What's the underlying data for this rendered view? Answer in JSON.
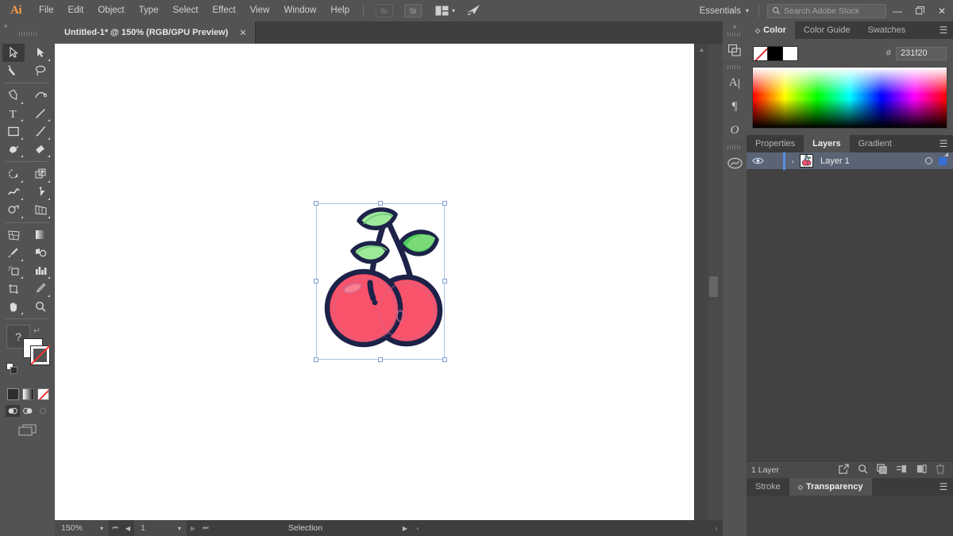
{
  "app": {
    "logo": "Ai",
    "menus": [
      "File",
      "Edit",
      "Object",
      "Type",
      "Select",
      "Effect",
      "View",
      "Window",
      "Help"
    ],
    "toolbar_buttons": [
      {
        "name": "bridge-button",
        "label": "Br",
        "enabled": false
      },
      {
        "name": "stock-button",
        "label": "St",
        "enabled": true
      }
    ],
    "arrange_documents_label": "",
    "workspace": {
      "label": "Essentials",
      "chevron": "▾"
    },
    "stock_search": {
      "placeholder": "Search Adobe Stock",
      "value": "",
      "icon": "search-icon"
    },
    "window_controls": {
      "minimize": "—",
      "restore": "❐",
      "close": "✕"
    }
  },
  "document_tab": {
    "title": "Untitled-1* @ 150% (RGB/GPU Preview)",
    "close": "✕"
  },
  "tools": {
    "items": [
      {
        "name": "selection-tool",
        "selected": true,
        "submenu": false
      },
      {
        "name": "direct-selection-tool",
        "selected": false,
        "submenu": true
      },
      {
        "name": "magic-wand-tool",
        "selected": false,
        "submenu": false
      },
      {
        "name": "lasso-tool",
        "selected": false,
        "submenu": false
      },
      {
        "name": "pen-tool",
        "selected": false,
        "submenu": true
      },
      {
        "name": "curvature-tool",
        "selected": false,
        "submenu": false
      },
      {
        "name": "type-tool",
        "selected": false,
        "submenu": true
      },
      {
        "name": "line-segment-tool",
        "selected": false,
        "submenu": true
      },
      {
        "name": "rectangle-tool",
        "selected": false,
        "submenu": true
      },
      {
        "name": "paintbrush-tool",
        "selected": false,
        "submenu": true
      },
      {
        "name": "shaper-tool",
        "selected": false,
        "submenu": true
      },
      {
        "name": "eraser-tool",
        "selected": false,
        "submenu": true
      },
      {
        "name": "rotate-tool",
        "selected": false,
        "submenu": true
      },
      {
        "name": "scale-tool",
        "selected": false,
        "submenu": true
      },
      {
        "name": "width-tool",
        "selected": false,
        "submenu": true
      },
      {
        "name": "free-transform-tool",
        "selected": false,
        "submenu": true
      },
      {
        "name": "shape-builder-tool",
        "selected": false,
        "submenu": true
      },
      {
        "name": "perspective-grid-tool",
        "selected": false,
        "submenu": true
      },
      {
        "name": "mesh-tool",
        "selected": false,
        "submenu": false
      },
      {
        "name": "gradient-tool",
        "selected": false,
        "submenu": false
      },
      {
        "name": "eyedropper-tool",
        "selected": false,
        "submenu": true
      },
      {
        "name": "blend-tool",
        "selected": false,
        "submenu": false
      },
      {
        "name": "symbol-sprayer-tool",
        "selected": false,
        "submenu": true
      },
      {
        "name": "column-graph-tool",
        "selected": false,
        "submenu": true
      },
      {
        "name": "artboard-tool",
        "selected": false,
        "submenu": false
      },
      {
        "name": "slice-tool",
        "selected": false,
        "submenu": true
      },
      {
        "name": "hand-tool",
        "selected": false,
        "submenu": true
      },
      {
        "name": "zoom-tool",
        "selected": false,
        "submenu": false
      }
    ],
    "help_label": "?",
    "fill_color": "#ffffff",
    "stroke_color": "#ffffff",
    "color_modes": [
      "color-mode",
      "gradient-mode",
      "none-mode"
    ],
    "draw_modes": [
      "draw-normal",
      "draw-behind",
      "draw-inside"
    ],
    "screen_mode": "change-screen-mode"
  },
  "canvas": {
    "artwork_name": "cherries-artwork",
    "colors": {
      "cherry_red": "#f9536b",
      "cherry_shade": "#e8506a",
      "leaf_light": "#9ee89a",
      "leaf_dark": "#4ccb5d",
      "leaf_mid": "#7ada78",
      "outline": "#1c2248",
      "highlight": "#fa7e8e"
    },
    "selection_color": "#9eb8e0"
  },
  "status_bar": {
    "zoom": "150%",
    "artboard_number": "1",
    "tool_status": "Selection",
    "nav_first": "⏮",
    "nav_prev": "◀",
    "nav_next": "▶",
    "nav_last": "⏭"
  },
  "icon_dock": {
    "collapse": "«",
    "icons": [
      {
        "name": "libraries-icon"
      },
      {
        "name": "character-panel-icon",
        "glyph": "A"
      },
      {
        "name": "paragraph-panel-icon",
        "glyph": "¶"
      },
      {
        "name": "opentype-panel-icon",
        "glyph": "O"
      },
      {
        "name": "creative-cloud-icon"
      }
    ]
  },
  "color_panel": {
    "tabs": [
      {
        "label": "Color",
        "active": true
      },
      {
        "label": "Color Guide",
        "active": false
      },
      {
        "label": "Swatches",
        "active": false
      }
    ],
    "menu_icon": "panel-menu-icon",
    "hex_symbol": "#",
    "hex_value": "231f20",
    "swatches": [
      "none-swatch",
      "black-swatch",
      "white-swatch"
    ]
  },
  "layers_panel": {
    "tabs": [
      {
        "label": "Properties",
        "active": false
      },
      {
        "label": "Layers",
        "active": true
      },
      {
        "label": "Gradient",
        "active": false
      }
    ],
    "menu_icon": "panel-menu-icon",
    "rows": [
      {
        "name": "Layer 1",
        "visible": true,
        "locked": false,
        "selected": true,
        "expand": "›",
        "eye": "◉"
      }
    ],
    "footer_count": "1 Layer",
    "footer_icons": [
      {
        "name": "locate-object-icon"
      },
      {
        "name": "make-clipping-mask-icon"
      },
      {
        "name": "create-new-sublayer-icon"
      },
      {
        "name": "create-new-layer-icon"
      },
      {
        "name": "delete-selection-icon",
        "dim": true
      }
    ]
  },
  "bottom_panel": {
    "tabs": [
      {
        "label": "Stroke",
        "active": false
      },
      {
        "label": "Transparency",
        "active": true
      }
    ],
    "menu_icon": "panel-menu-icon"
  }
}
